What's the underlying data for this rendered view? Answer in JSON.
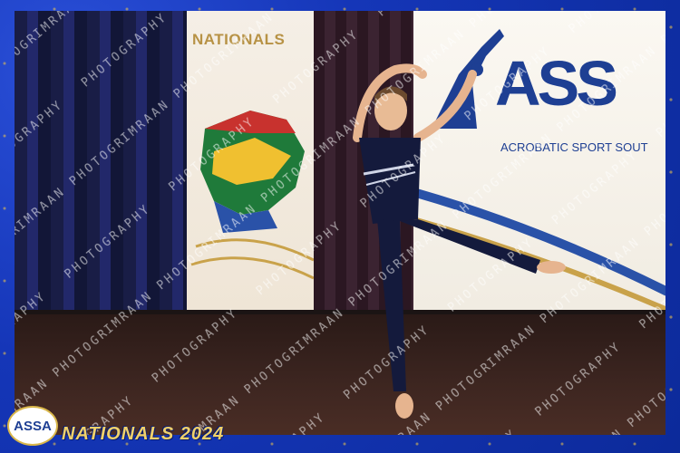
{
  "banner_left": {
    "title": "NATIONALS"
  },
  "banner_right": {
    "logo_text": "ASS",
    "tagline": "ACROBATIC SPORT SOUT"
  },
  "footer": {
    "logo_text": "ASSA",
    "title": "NATIONALS 2024"
  },
  "watermark": {
    "text": "IMRAAN PHOTOGRAPHY"
  },
  "colors": {
    "frame": "#1536b8",
    "gold": "#f0d16a",
    "brand_blue": "#1e3f93",
    "costume": "#141a3c"
  }
}
